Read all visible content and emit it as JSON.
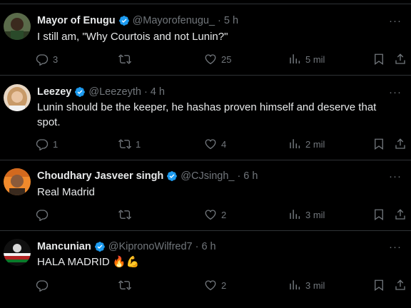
{
  "tweets": [
    {
      "name": "Mayor of Enugu",
      "handle": "@Mayorofenugu_",
      "time": "5 h",
      "text": "I still am, \"Why Courtois and not Lunin?\"",
      "replies": "3",
      "retweets": "",
      "likes": "25",
      "views": "5 mil",
      "avatar_color": "#4a5a3a"
    },
    {
      "name": "Leezey",
      "handle": "@Leezeyth",
      "time": "4 h",
      "text": "Lunin should be the keeper, he hashas proven himself and deserve that spot.",
      "replies": "1",
      "retweets": "1",
      "likes": "4",
      "views": "2 mil",
      "avatar_color": "#d9b48a"
    },
    {
      "name": "Choudhary Jasveer singh",
      "handle": "@CJsingh_",
      "time": "6 h",
      "text": "Real Madrid",
      "replies": "",
      "retweets": "",
      "likes": "2",
      "views": "3 mil",
      "avatar_color": "#e07b2a"
    },
    {
      "name": "Mancunian",
      "handle": "@KipronoWilfred7",
      "time": "6 h",
      "text": "HALA MADRID 🔥💪",
      "replies": "",
      "retweets": "",
      "likes": "2",
      "views": "3 mil",
      "avatar_color": "#1a1a1a"
    }
  ],
  "separator": "·",
  "more_glyph": "···",
  "colors": {
    "background": "#000000",
    "text": "#e7e9ea",
    "muted": "#71767b",
    "verified": "#1d9bf0",
    "divider": "#2f3336"
  }
}
